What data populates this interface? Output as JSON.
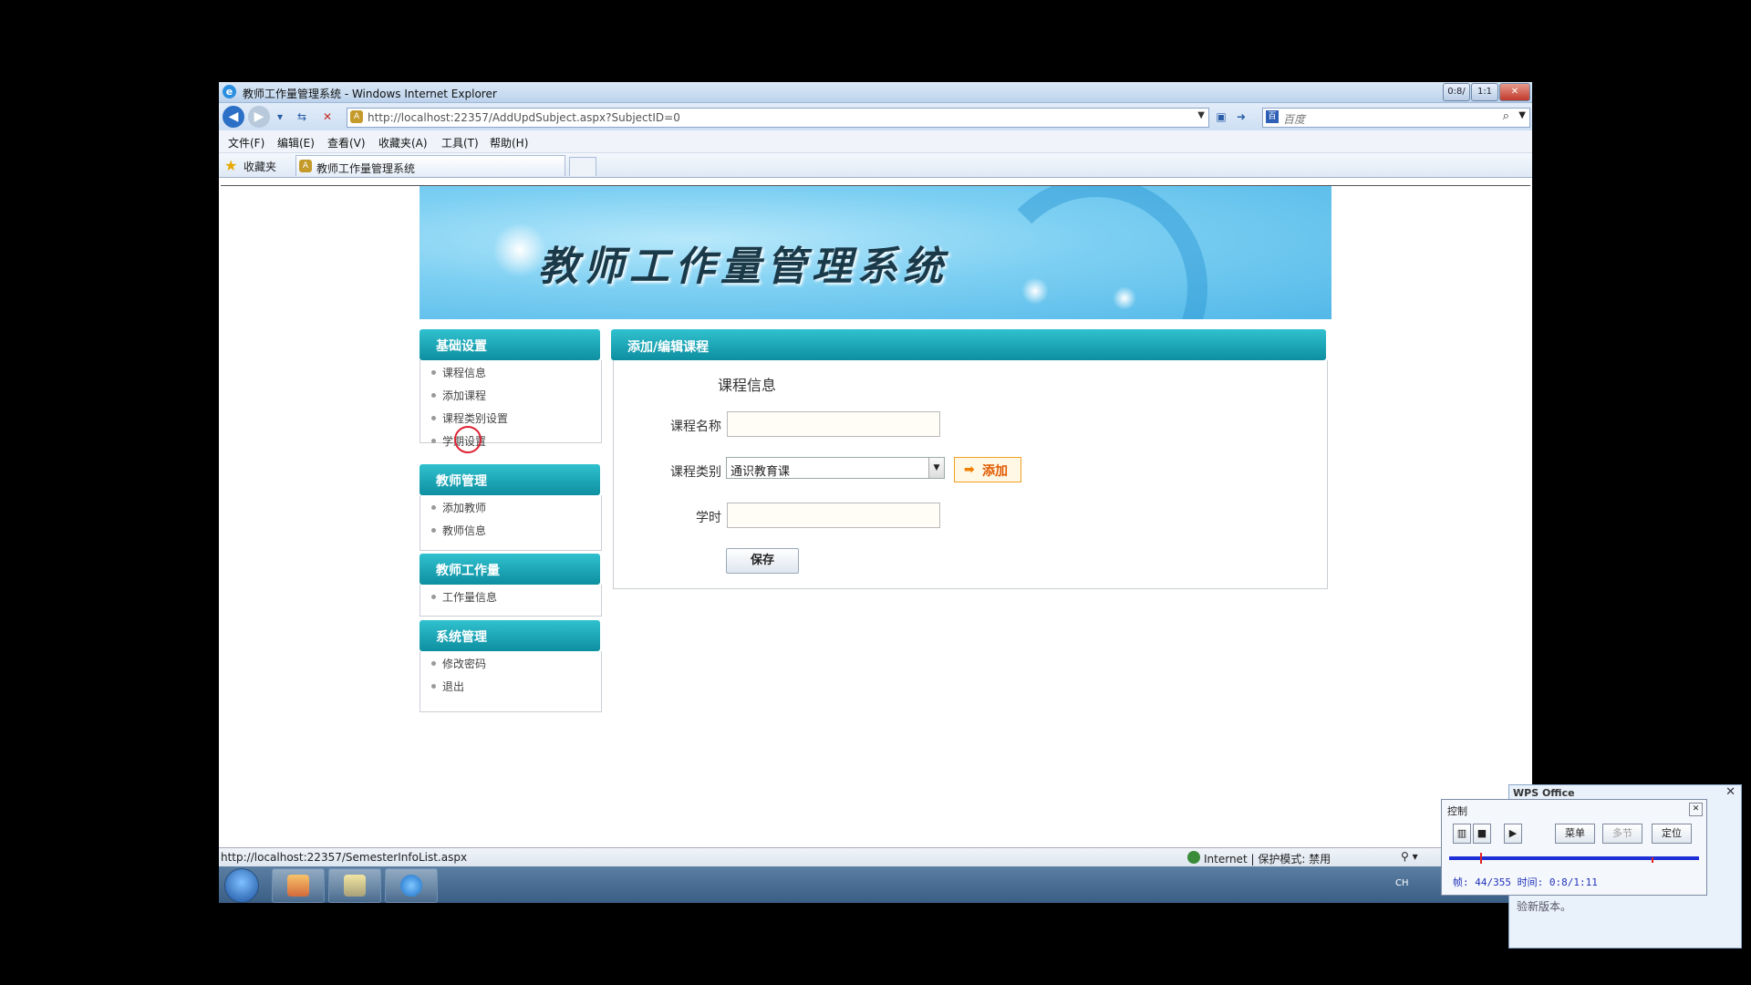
{
  "window": {
    "title": "教师工作量管理系统 - Windows Internet Explorer",
    "minimize_label": "0:8/",
    "restore_label": "1:1",
    "close_label": "✕"
  },
  "navbar": {
    "address_url": "http://localhost:22357/AddUpdSubject.aspx?SubjectID=0",
    "search_placeholder": "百度"
  },
  "menu": [
    "文件(F)",
    "编辑(E)",
    "查看(V)",
    "收藏夹(A)",
    "工具(T)",
    "帮助(H)"
  ],
  "favorites": {
    "label": "收藏夹",
    "tab_title": "教师工作量管理系统"
  },
  "banner": {
    "title": "教师工作量管理系统"
  },
  "sidebar": {
    "sections": [
      {
        "title": "基础设置",
        "links": [
          "课程信息",
          "添加课程",
          "课程类别设置",
          "学期设置"
        ]
      },
      {
        "title": "教师管理",
        "links": [
          "添加教师",
          "教师信息"
        ]
      },
      {
        "title": "教师工作量",
        "links": [
          "工作量信息"
        ]
      },
      {
        "title": "系统管理",
        "links": [
          "修改密码",
          "退出"
        ]
      }
    ]
  },
  "main": {
    "header": "添加/编辑课程",
    "form_title": "课程信息",
    "name_label": "课程名称",
    "name_value": "",
    "category_label": "课程类别",
    "category_value": "通识教育课",
    "add_label": "添加",
    "hours_label": "学时",
    "hours_value": "",
    "save_label": "保存"
  },
  "status": {
    "url": "http://localhost:22357/SemesterInfoList.aspx",
    "zone": "Internet | 保护模式: 禁用"
  },
  "tray": {
    "lang": "CH"
  },
  "wps": {
    "logo": "WPS Office",
    "message": "验新版本。",
    "panel_title": "控制",
    "buttons": [
      "菜单",
      "多节",
      "定位"
    ],
    "info": "帧: 44/355 时间: 0:8/1:11",
    "progress_fraction": 0.124
  }
}
